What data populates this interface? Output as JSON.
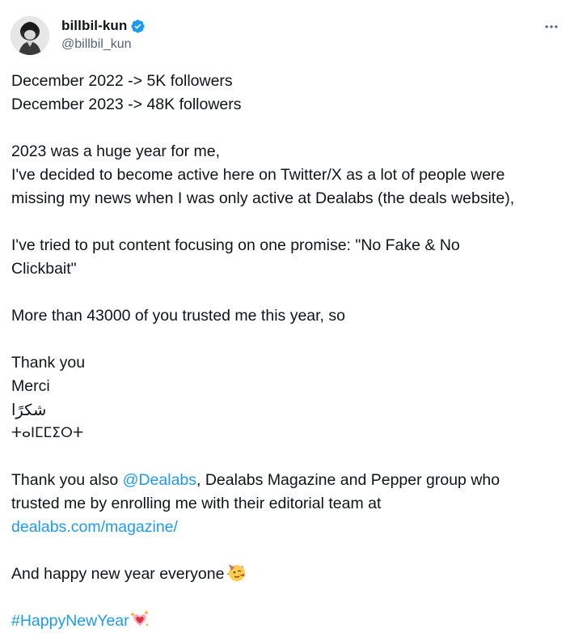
{
  "user": {
    "display_name": "billbil-kun",
    "handle": "@billbil_kun",
    "verified_icon": "verified-badge-icon",
    "verified_color": "#1d9bf0"
  },
  "menu": {
    "icon": "more-options-icon"
  },
  "tweet": {
    "line1": "December 2022 -> 5K followers",
    "line2": "December 2023 -> 48K followers",
    "line3": "2023 was a huge year for me,",
    "line4": "I've decided to become active here on Twitter/X as a lot of people were",
    "line5": "missing my news when I was only active at Dealabs (the deals website),",
    "line6": "I've tried to put content focusing on one promise: \"No Fake & No",
    "line7": "Clickbait\"",
    "line8": "More than 43000 of you trusted me this year, so",
    "thanks_en": "Thank you",
    "thanks_fr": "Merci",
    "thanks_ar": "شكرًا",
    "thanks_tz": "ⵜⴰⵏⵎⵎⵉⵔⵜ",
    "thanks_also_prefix": "Thank you also ",
    "mention": "@Dealabs",
    "thanks_also_suffix": ", Dealabs Magazine and Pepper group who",
    "line_trusted": "trusted me by enrolling me with their editorial team at",
    "url": "dealabs.com/magazine/",
    "new_year": "And happy new year everyone",
    "new_year_emoji": "partying-face-emoji",
    "hashtag": "#HappyNewYear",
    "hashtag_emoji": "sparkling-heart-emoji"
  },
  "colors": {
    "text": "#0f1419",
    "secondary": "#536471",
    "link": "#1d9bf0"
  }
}
